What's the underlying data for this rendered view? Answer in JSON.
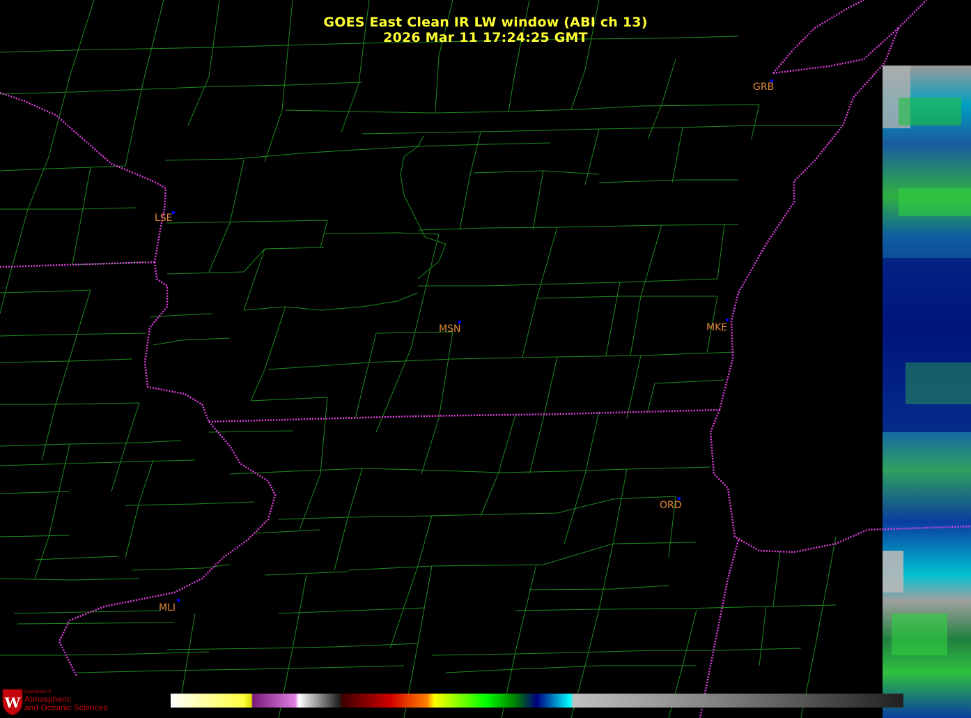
{
  "title": {
    "line1": "GOES East Clean IR LW window (ABI ch 13)",
    "line2": "2026 Mar 11  17:24:25 GMT"
  },
  "cities": [
    {
      "code": "GRB"
    },
    {
      "code": "LSE"
    },
    {
      "code": "MSN"
    },
    {
      "code": "MKE"
    },
    {
      "code": "ORD"
    },
    {
      "code": "MLI"
    }
  ],
  "logo": {
    "line_small": "Department of",
    "line1": "Atmospheric",
    "line2": "and Oceanic Sciences"
  },
  "colors": {
    "background": "#000000",
    "county_lines": "#1f8a1f",
    "state_borders": "#e040e0",
    "title_text": "#ffff33",
    "city_labels": "#e08a3a",
    "city_markers": "#0000ff",
    "logo": "#c5050c"
  },
  "colorbar": {
    "stops": [
      "#ffffff",
      "#ffff40",
      "#e0e000",
      "#7a1a7a",
      "#e080e0",
      "#ffffff",
      "#202020",
      "#400000",
      "#d00000",
      "#ff8000",
      "#ffff00",
      "#00ff00",
      "#008000",
      "#000080",
      "#00ffff",
      "#c0c0c0",
      "#808080",
      "#202020"
    ]
  }
}
